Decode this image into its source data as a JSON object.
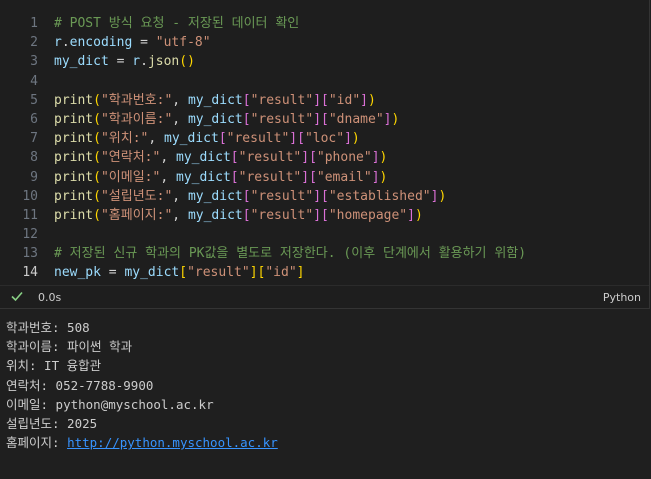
{
  "cell": {
    "lines": [
      {
        "n": "1",
        "tokens": [
          {
            "t": "# POST 방식 요청 - 저장된 데이터 확인",
            "c": "comment"
          }
        ]
      },
      {
        "n": "2",
        "tokens": [
          {
            "t": "r",
            "c": "var"
          },
          {
            "t": ".",
            "c": "op"
          },
          {
            "t": "encoding",
            "c": "var"
          },
          {
            "t": " = ",
            "c": "op"
          },
          {
            "t": "\"utf-8\"",
            "c": "str"
          }
        ]
      },
      {
        "n": "3",
        "tokens": [
          {
            "t": "my_dict",
            "c": "var"
          },
          {
            "t": " = ",
            "c": "op"
          },
          {
            "t": "r",
            "c": "var"
          },
          {
            "t": ".",
            "c": "op"
          },
          {
            "t": "json",
            "c": "func"
          },
          {
            "t": "()",
            "c": "b1"
          }
        ]
      },
      {
        "n": "4",
        "tokens": []
      },
      {
        "n": "5",
        "tokens": [
          {
            "t": "print",
            "c": "func"
          },
          {
            "t": "(",
            "c": "b1"
          },
          {
            "t": "\"학과번호:\"",
            "c": "str"
          },
          {
            "t": ", ",
            "c": "op"
          },
          {
            "t": "my_dict",
            "c": "var"
          },
          {
            "t": "[",
            "c": "b2"
          },
          {
            "t": "\"result\"",
            "c": "str"
          },
          {
            "t": "]",
            "c": "b2"
          },
          {
            "t": "[",
            "c": "b2"
          },
          {
            "t": "\"id\"",
            "c": "str"
          },
          {
            "t": "]",
            "c": "b2"
          },
          {
            "t": ")",
            "c": "b1"
          }
        ]
      },
      {
        "n": "6",
        "tokens": [
          {
            "t": "print",
            "c": "func"
          },
          {
            "t": "(",
            "c": "b1"
          },
          {
            "t": "\"학과이름:\"",
            "c": "str"
          },
          {
            "t": ", ",
            "c": "op"
          },
          {
            "t": "my_dict",
            "c": "var"
          },
          {
            "t": "[",
            "c": "b2"
          },
          {
            "t": "\"result\"",
            "c": "str"
          },
          {
            "t": "]",
            "c": "b2"
          },
          {
            "t": "[",
            "c": "b2"
          },
          {
            "t": "\"dname\"",
            "c": "str"
          },
          {
            "t": "]",
            "c": "b2"
          },
          {
            "t": ")",
            "c": "b1"
          }
        ]
      },
      {
        "n": "7",
        "tokens": [
          {
            "t": "print",
            "c": "func"
          },
          {
            "t": "(",
            "c": "b1"
          },
          {
            "t": "\"위치:\"",
            "c": "str"
          },
          {
            "t": ", ",
            "c": "op"
          },
          {
            "t": "my_dict",
            "c": "var"
          },
          {
            "t": "[",
            "c": "b2"
          },
          {
            "t": "\"result\"",
            "c": "str"
          },
          {
            "t": "]",
            "c": "b2"
          },
          {
            "t": "[",
            "c": "b2"
          },
          {
            "t": "\"loc\"",
            "c": "str"
          },
          {
            "t": "]",
            "c": "b2"
          },
          {
            "t": ")",
            "c": "b1"
          }
        ]
      },
      {
        "n": "8",
        "tokens": [
          {
            "t": "print",
            "c": "func"
          },
          {
            "t": "(",
            "c": "b1"
          },
          {
            "t": "\"연락처:\"",
            "c": "str"
          },
          {
            "t": ", ",
            "c": "op"
          },
          {
            "t": "my_dict",
            "c": "var"
          },
          {
            "t": "[",
            "c": "b2"
          },
          {
            "t": "\"result\"",
            "c": "str"
          },
          {
            "t": "]",
            "c": "b2"
          },
          {
            "t": "[",
            "c": "b2"
          },
          {
            "t": "\"phone\"",
            "c": "str"
          },
          {
            "t": "]",
            "c": "b2"
          },
          {
            "t": ")",
            "c": "b1"
          }
        ]
      },
      {
        "n": "9",
        "tokens": [
          {
            "t": "print",
            "c": "func"
          },
          {
            "t": "(",
            "c": "b1"
          },
          {
            "t": "\"이메일:\"",
            "c": "str"
          },
          {
            "t": ", ",
            "c": "op"
          },
          {
            "t": "my_dict",
            "c": "var"
          },
          {
            "t": "[",
            "c": "b2"
          },
          {
            "t": "\"result\"",
            "c": "str"
          },
          {
            "t": "]",
            "c": "b2"
          },
          {
            "t": "[",
            "c": "b2"
          },
          {
            "t": "\"email\"",
            "c": "str"
          },
          {
            "t": "]",
            "c": "b2"
          },
          {
            "t": ")",
            "c": "b1"
          }
        ]
      },
      {
        "n": "10",
        "tokens": [
          {
            "t": "print",
            "c": "func"
          },
          {
            "t": "(",
            "c": "b1"
          },
          {
            "t": "\"설립년도:\"",
            "c": "str"
          },
          {
            "t": ", ",
            "c": "op"
          },
          {
            "t": "my_dict",
            "c": "var"
          },
          {
            "t": "[",
            "c": "b2"
          },
          {
            "t": "\"result\"",
            "c": "str"
          },
          {
            "t": "]",
            "c": "b2"
          },
          {
            "t": "[",
            "c": "b2"
          },
          {
            "t": "\"established\"",
            "c": "str"
          },
          {
            "t": "]",
            "c": "b2"
          },
          {
            "t": ")",
            "c": "b1"
          }
        ]
      },
      {
        "n": "11",
        "tokens": [
          {
            "t": "print",
            "c": "func"
          },
          {
            "t": "(",
            "c": "b1"
          },
          {
            "t": "\"홈페이지:\"",
            "c": "str"
          },
          {
            "t": ", ",
            "c": "op"
          },
          {
            "t": "my_dict",
            "c": "var"
          },
          {
            "t": "[",
            "c": "b2"
          },
          {
            "t": "\"result\"",
            "c": "str"
          },
          {
            "t": "]",
            "c": "b2"
          },
          {
            "t": "[",
            "c": "b2"
          },
          {
            "t": "\"homepage\"",
            "c": "str"
          },
          {
            "t": "]",
            "c": "b2"
          },
          {
            "t": ")",
            "c": "b1"
          }
        ]
      },
      {
        "n": "12",
        "tokens": []
      },
      {
        "n": "13",
        "tokens": [
          {
            "t": "# 저장된 신규 학과의 PK값을 별도로 저장한다. (이후 단계에서 활용하기 위함)",
            "c": "comment"
          }
        ]
      },
      {
        "n": "14",
        "active": true,
        "tokens": [
          {
            "t": "new_pk",
            "c": "var"
          },
          {
            "t": " = ",
            "c": "op"
          },
          {
            "t": "my_dict",
            "c": "var"
          },
          {
            "t": "[",
            "c": "b1"
          },
          {
            "t": "\"result\"",
            "c": "str"
          },
          {
            "t": "]",
            "c": "b1"
          },
          {
            "t": "[",
            "c": "b1"
          },
          {
            "t": "\"id\"",
            "c": "str"
          },
          {
            "t": "]",
            "c": "b1"
          }
        ]
      }
    ],
    "status": {
      "check_icon": "check-icon",
      "elapsed": "0.0s",
      "language": "Python",
      "success_color": "#89d185"
    }
  },
  "output": {
    "lines": [
      {
        "text": "학과번호: 508"
      },
      {
        "text": "학과이름: 파이썬 학과"
      },
      {
        "text": "위치: IT 융합관"
      },
      {
        "text": "연락처: 052-7788-9900"
      },
      {
        "text": "이메일: python@myschool.ac.kr"
      },
      {
        "text": "설립년도: 2025"
      },
      {
        "text": "홈페이지: ",
        "link": "http://python.myschool.ac.kr"
      }
    ],
    "link_color": "#3794ff"
  }
}
